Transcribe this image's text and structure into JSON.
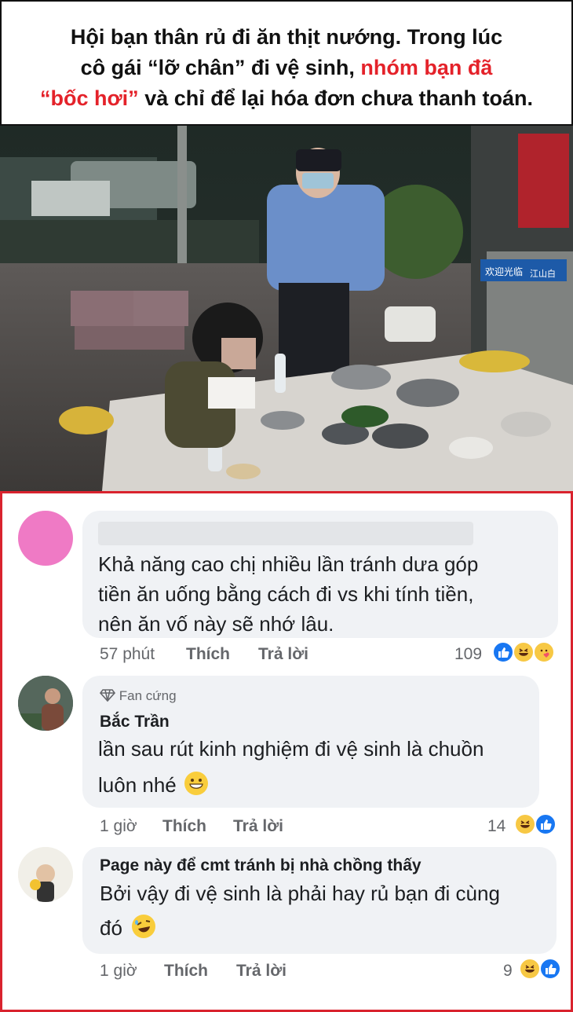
{
  "headline": {
    "line1": "Hội bạn thân rủ đi ăn thịt nướng. Trong lúc",
    "line2_black": "cô gái “lỡ chân” đi vệ sinh,",
    "line2_red": "nhóm bạn đã",
    "line3_red": "“bốc hơi”",
    "line3_black": "và chỉ để lại hóa đơn chưa thanh toán."
  },
  "photo": {
    "signs": [
      "欢迎光临",
      "江山白"
    ]
  },
  "comments": [
    {
      "text_line1": "Khả năng cao chị nhiều lần tránh dưa góp",
      "text_line2": "tiền ăn uống bằng cách đi vs khi tính tiền,",
      "text_line3": "nên ăn vố này sẽ nhớ lâu.",
      "time": "57 phút",
      "like": "Thích",
      "reply": "Trả lời",
      "reaction_count": "109"
    },
    {
      "badge": "Fan cứng",
      "name": "Bắc Trần",
      "text_line1": "lần sau rút kinh nghiệm đi vệ sinh là chuồn",
      "text_line2": "luôn nhé",
      "time": "1 giờ",
      "like": "Thích",
      "reply": "Trả lời",
      "reaction_count": "14"
    },
    {
      "name": "Page này để cmt tránh bị nhà chồng thấy",
      "text_line1": "Bởi vậy đi vệ sinh là phải hay rủ bạn đi cùng",
      "text_line2": "đó",
      "time": "1 giờ",
      "like": "Thích",
      "reply": "Trả lời",
      "reaction_count": "9"
    }
  ],
  "colors": {
    "accent_red": "#e4222a",
    "frame_red": "#d9232e",
    "bubble": "#f0f2f5",
    "like_blue": "#1877f2"
  },
  "icons": [
    "diamond-icon",
    "like-reaction-icon",
    "haha-reaction-icon",
    "care-reaction-icon",
    "grin-emoji-icon",
    "rofl-emoji-icon"
  ]
}
